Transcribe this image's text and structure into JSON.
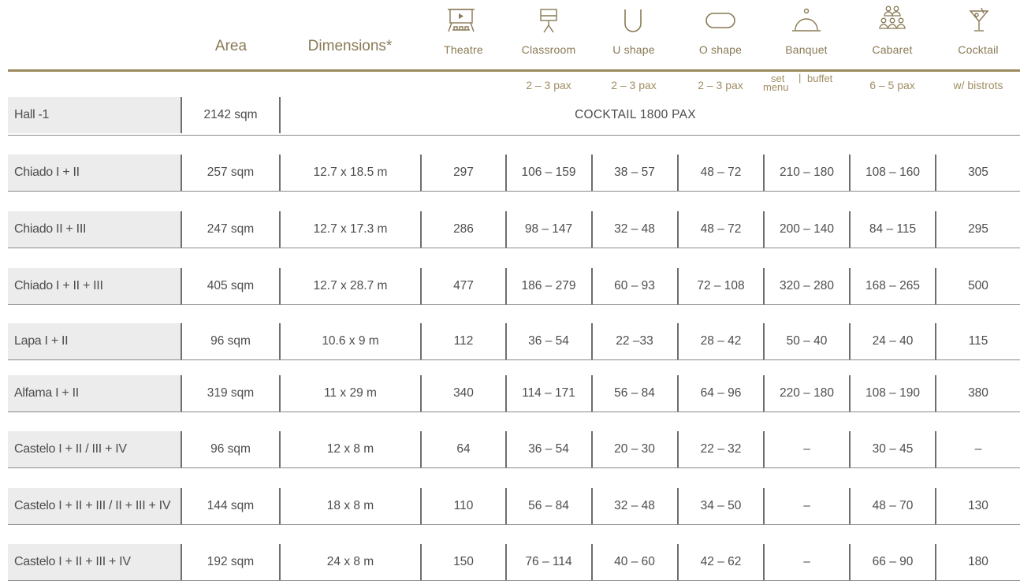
{
  "header": {
    "area_label": "Area",
    "dimensions_label": "Dimensions*",
    "layouts": [
      {
        "label": "Theatre",
        "icon": "theatre-icon",
        "sub": ""
      },
      {
        "label": "Classroom",
        "icon": "classroom-icon",
        "sub": "2 – 3 pax"
      },
      {
        "label": "U shape",
        "icon": "u-shape-icon",
        "sub": "2 – 3 pax"
      },
      {
        "label": "O shape",
        "icon": "o-shape-icon",
        "sub": "2 – 3 pax"
      },
      {
        "label": "Banquet",
        "icon": "banquet-icon",
        "sub": ""
      },
      {
        "label": "Cabaret",
        "icon": "cabaret-icon",
        "sub": "6 – 5 pax"
      },
      {
        "label": "Cocktail",
        "icon": "cocktail-icon",
        "sub": "w/ bistrots"
      }
    ],
    "banquet_sub": {
      "set": "set",
      "menu": "menu",
      "sep": "|",
      "buffet": "buffet"
    }
  },
  "colors": {
    "accent": "#9c8a5f",
    "label_bg": "#ececec",
    "text": "#4d4d4d"
  },
  "hall": {
    "name": "Hall -1",
    "area": "2142 sqm",
    "note": "COCKTAIL 1800 PAX"
  },
  "rooms": [
    {
      "name": "Chiado I + II",
      "area": "257 sqm",
      "dimensions": "12.7 x 18.5 m",
      "theatre": "297",
      "classroom": "106 – 159",
      "ushape": "38 – 57",
      "oshape": "48 – 72",
      "banquet": "210 – 180",
      "cabaret": "108 – 160",
      "cocktail": "305"
    },
    {
      "name": "Chiado II + III",
      "area": "247 sqm",
      "dimensions": "12.7 x 17.3 m",
      "theatre": "286",
      "classroom": "98 – 147",
      "ushape": "32 – 48",
      "oshape": "48 – 72",
      "banquet": "200 – 140",
      "cabaret": "84 – 115",
      "cocktail": "295"
    },
    {
      "name": "Chiado I + II + III",
      "area": "405 sqm",
      "dimensions": "12.7 x 28.7 m",
      "theatre": "477",
      "classroom": "186 – 279",
      "ushape": "60 – 93",
      "oshape": "72 – 108",
      "banquet": "320 – 280",
      "cabaret": "168 – 265",
      "cocktail": "500"
    },
    {
      "name": "Lapa I + II",
      "area": "96 sqm",
      "dimensions": "10.6 x 9 m",
      "theatre": "112",
      "classroom": "36 – 54",
      "ushape": "22 –33",
      "oshape": "28 – 42",
      "banquet": "50 – 40",
      "cabaret": "24 – 40",
      "cocktail": "115"
    },
    {
      "name": "Alfama I + II",
      "area": "319 sqm",
      "dimensions": "11 x 29 m",
      "theatre": "340",
      "classroom": "114 – 171",
      "ushape": "56 – 84",
      "oshape": "64 – 96",
      "banquet": "220 – 180",
      "cabaret": "108 – 190",
      "cocktail": "380"
    },
    {
      "name": "Castelo I + II / III + IV",
      "area": "96 sqm",
      "dimensions": "12 x 8 m",
      "theatre": "64",
      "classroom": "36 – 54",
      "ushape": "20 – 30",
      "oshape": "22 – 32",
      "banquet": "–",
      "cabaret": "30 – 45",
      "cocktail": "–"
    },
    {
      "name": "Castelo I + II + III / II + III + IV",
      "area": "144 sqm",
      "dimensions": "18 x 8 m",
      "theatre": "110",
      "classroom": "56 – 84",
      "ushape": "32 – 48",
      "oshape": "34 – 50",
      "banquet": "–",
      "cabaret": "48 – 70",
      "cocktail": "130"
    },
    {
      "name": "Castelo  I + II + III + IV",
      "area": "192 sqm",
      "dimensions": "24 x 8 m",
      "theatre": "150",
      "classroom": "76 – 114",
      "ushape": "40 – 60",
      "oshape": "42 – 62",
      "banquet": "–",
      "cabaret": "66 – 90",
      "cocktail": "180"
    }
  ]
}
